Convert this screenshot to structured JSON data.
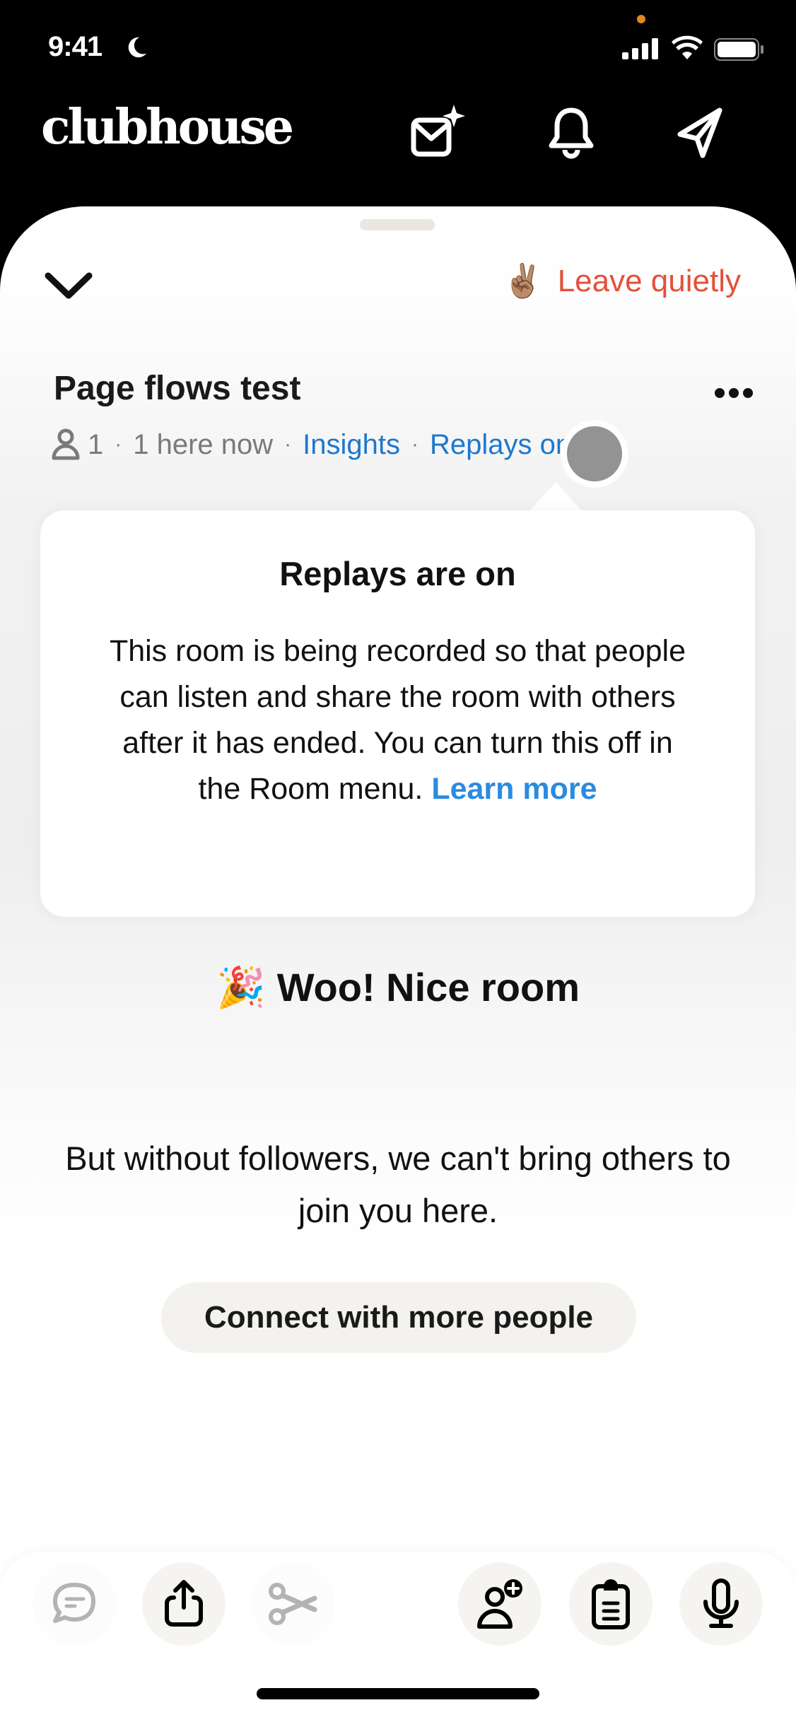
{
  "status_bar": {
    "time": "9:41",
    "focus_icon": "moon-icon",
    "icons": [
      "cellular-signal-icon",
      "wifi-icon",
      "battery-icon"
    ]
  },
  "header": {
    "logo": "clubhouse",
    "icons": [
      "new-message-icon",
      "bell-icon",
      "send-icon"
    ]
  },
  "room": {
    "leave_emoji": "✌🏽",
    "leave_label": "Leave quietly",
    "title": "Page flows test",
    "participant_count": "1",
    "here_now": "1 here now",
    "insights_label": "Insights",
    "replays_label": "Replays on",
    "separator": "·"
  },
  "tooltip": {
    "title": "Replays are on",
    "body": "This room is being recorded so that people can listen and share the room with others after it has ended. You can turn this off in the Room menu.",
    "link": "Learn more"
  },
  "empty_state": {
    "emoji": "🎉",
    "headline": "Woo! Nice room",
    "message": "But without followers, we can't bring others to join you here.",
    "cta": "Connect with more people"
  },
  "bottom_bar": {
    "buttons": [
      {
        "name": "chat",
        "icon": "chat-bubble-icon",
        "enabled": false
      },
      {
        "name": "share",
        "icon": "share-icon",
        "enabled": true
      },
      {
        "name": "clip",
        "icon": "scissors-icon",
        "enabled": false
      },
      {
        "name": "invite",
        "icon": "add-user-icon",
        "enabled": true
      },
      {
        "name": "notes",
        "icon": "clipboard-icon",
        "enabled": true
      },
      {
        "name": "mic",
        "icon": "microphone-icon",
        "enabled": true
      }
    ]
  },
  "colors": {
    "leave": "#e4503a",
    "link": "#1e78cc",
    "learn_more": "#2a8be0",
    "button_bg": "#f3f2ee"
  }
}
